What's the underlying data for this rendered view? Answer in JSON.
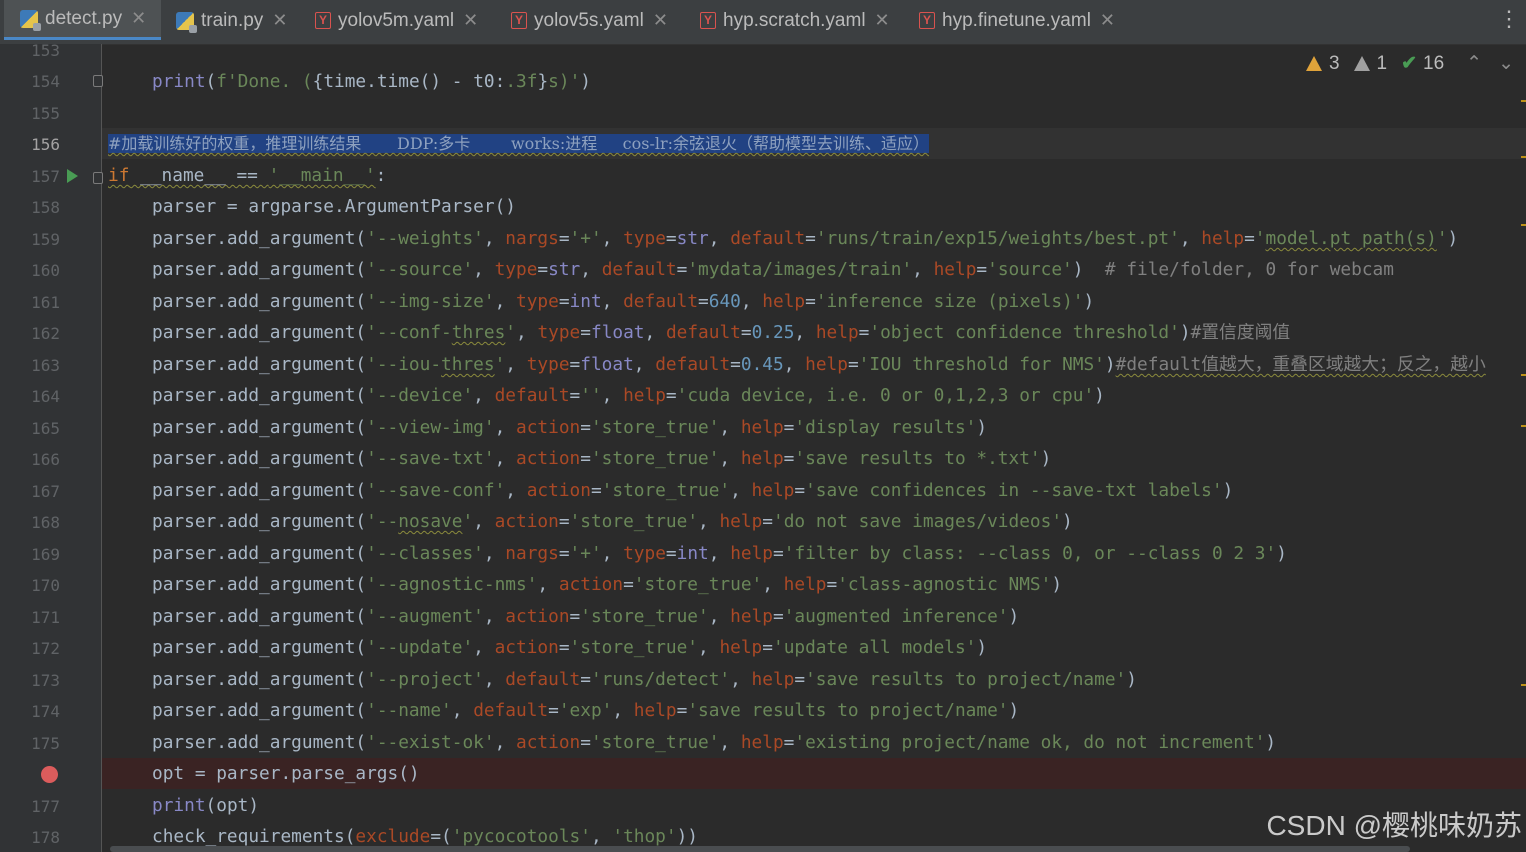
{
  "tabs": [
    {
      "label": "detect.py",
      "icon": "python-file-icon",
      "active": true
    },
    {
      "label": "train.py",
      "icon": "python-file-icon"
    },
    {
      "label": "yolov5m.yaml",
      "icon": "yaml-file-icon"
    },
    {
      "label": "yolov5s.yaml",
      "icon": "yaml-file-icon"
    },
    {
      "label": "hyp.scratch.yaml",
      "icon": "yaml-file-icon"
    },
    {
      "label": "hyp.finetune.yaml",
      "icon": "yaml-file-icon"
    }
  ],
  "inspections": {
    "warnings": "3",
    "weak_warnings": "1",
    "ok": "16"
  },
  "line_numbers": [
    "153",
    "154",
    "155",
    "156",
    "157",
    "158",
    "159",
    "160",
    "161",
    "162",
    "163",
    "164",
    "165",
    "166",
    "167",
    "168",
    "169",
    "170",
    "171",
    "172",
    "173",
    "174",
    "175",
    "",
    "177",
    "178"
  ],
  "current_line": "156",
  "code": {
    "l154": "print(f'Done. ({time.time() - t0:.3f}s)')",
    "l156_comment": "#加载训练好的权重，推理训练结果       DDP:多卡        works:进程     cos-lr:余弦退火（帮助模型去训练、适应）",
    "l157": "if __name__ == '__main__':",
    "l158": "parser = argparse.ArgumentParser()",
    "l159": "parser.add_argument('--weights', nargs='+', type=str, default='runs/train/exp15/weights/best.pt', help='model.pt path(s)')",
    "l160": "parser.add_argument('--source', type=str, default='mydata/images/train', help='source')  # file/folder, 0 for webcam",
    "l161": "parser.add_argument('--img-size', type=int, default=640, help='inference size (pixels)')",
    "l162": "parser.add_argument('--conf-thres', type=float, default=0.25, help='object confidence threshold')#置信度阈值",
    "l163": "parser.add_argument('--iou-thres', type=float, default=0.45, help='IOU threshold for NMS')#default值越大，重叠区域越大；反之，越小",
    "l164": "parser.add_argument('--device', default='', help='cuda device, i.e. 0 or 0,1,2,3 or cpu')",
    "l165": "parser.add_argument('--view-img', action='store_true', help='display results')",
    "l166": "parser.add_argument('--save-txt', action='store_true', help='save results to *.txt')",
    "l167": "parser.add_argument('--save-conf', action='store_true', help='save confidences in --save-txt labels')",
    "l168": "parser.add_argument('--nosave', action='store_true', help='do not save images/videos')",
    "l169": "parser.add_argument('--classes', nargs='+', type=int, help='filter by class: --class 0, or --class 0 2 3')",
    "l170": "parser.add_argument('--agnostic-nms', action='store_true', help='class-agnostic NMS')",
    "l171": "parser.add_argument('--augment', action='store_true', help='augmented inference')",
    "l172": "parser.add_argument('--update', action='store_true', help='update all models')",
    "l173": "parser.add_argument('--project', default='runs/detect', help='save results to project/name')",
    "l174": "parser.add_argument('--name', default='exp', help='save results to project/name')",
    "l175": "parser.add_argument('--exist-ok', action='store_true', help='existing project/name ok, do not increment')",
    "l176": "opt = parser.parse_args()",
    "l177": "print(opt)",
    "l178": "check_requirements(exclude=('pycocotools', 'thop'))"
  },
  "watermark": "CSDN @樱桃味奶苏",
  "colors": {
    "keyword": "#cc7832",
    "string": "#6a8759",
    "number": "#6897bb",
    "builtin": "#8888c6",
    "kwarg": "#aa4926",
    "selection": "#214283",
    "breakpoint": "#db5c5c"
  }
}
